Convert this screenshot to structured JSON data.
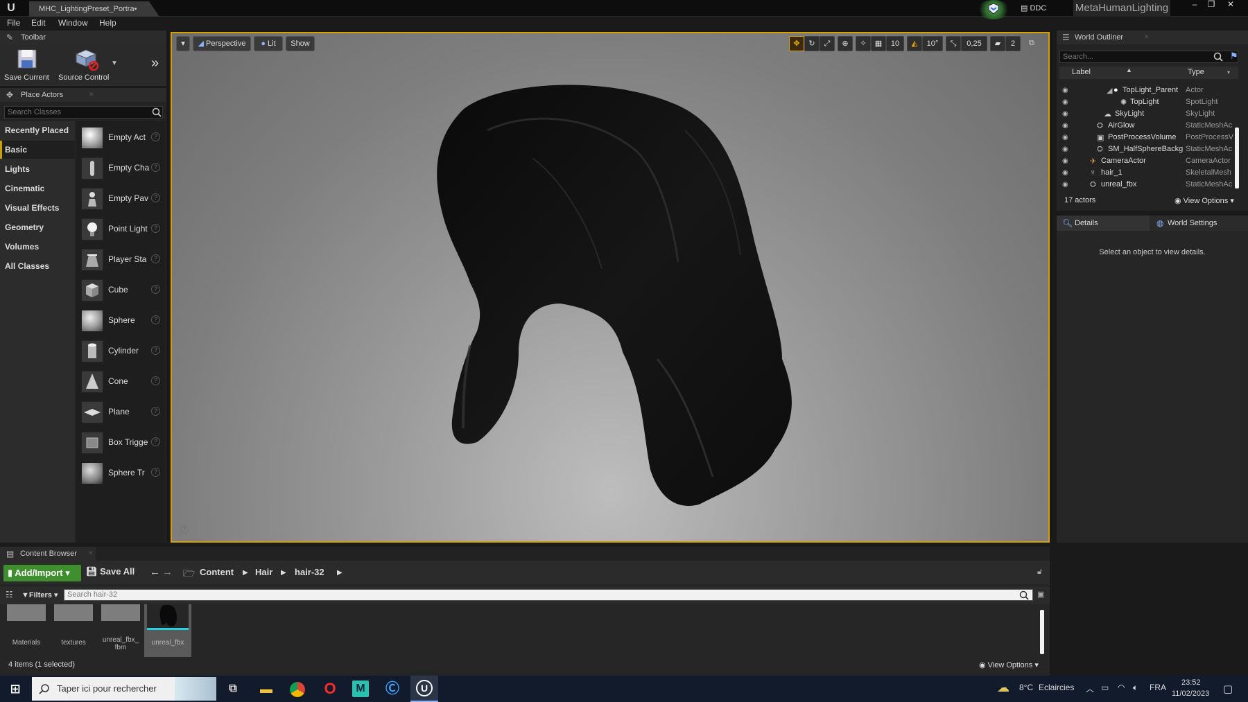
{
  "window": {
    "tab_title": "MHC_LightingPreset_Portra•",
    "ddc_label": "DDC",
    "project_name": "MetaHumanLighting"
  },
  "menu": {
    "items": [
      "File",
      "Edit",
      "Window",
      "Help"
    ]
  },
  "toolbar": {
    "title": "Toolbar",
    "save_label": "Save Current",
    "source_label": "Source Control"
  },
  "place_actors": {
    "title": "Place Actors",
    "search_placeholder": "Search Classes",
    "categories": [
      "Recently Placed",
      "Basic",
      "Lights",
      "Cinematic",
      "Visual Effects",
      "Geometry",
      "Volumes",
      "All Classes"
    ],
    "selected_category": "Basic",
    "items": [
      "Empty Act",
      "Empty Cha",
      "Empty Pav",
      "Point Light",
      "Player Sta",
      "Cube",
      "Sphere",
      "Cylinder",
      "Cone",
      "Plane",
      "Box Trigge",
      "Sphere Tr"
    ]
  },
  "viewport": {
    "perspective_label": "Perspective",
    "lit_label": "Lit",
    "show_label": "Show",
    "grid_snap": "10",
    "angle_snap": "10°",
    "scale_snap": "0,25",
    "camera_speed": "2"
  },
  "outliner": {
    "title": "World Outliner",
    "search_placeholder": "Search...",
    "col_label": "Label",
    "col_type": "Type",
    "rows": [
      {
        "label": "TopLight_Parent",
        "type": "Actor"
      },
      {
        "label": "TopLight",
        "type": "SpotLight"
      },
      {
        "label": "SkyLight",
        "type": "SkyLight"
      },
      {
        "label": "AirGlow",
        "type": "StaticMeshAc"
      },
      {
        "label": "PostProcessVolume",
        "type": "PostProcessV"
      },
      {
        "label": "SM_HalfSphereBackg",
        "type": "StaticMeshAc"
      },
      {
        "label": "CameraActor",
        "type": "CameraActor"
      },
      {
        "label": "hair_1",
        "type": "SkeletalMesh"
      },
      {
        "label": "unreal_fbx",
        "type": "StaticMeshAc"
      }
    ],
    "actor_count": "17 actors",
    "view_options": "View Options"
  },
  "details": {
    "tab_details": "Details",
    "tab_world_settings": "World Settings",
    "empty_message": "Select an object to view details."
  },
  "content_browser": {
    "title": "Content Browser",
    "add_import": "Add/Import",
    "save_all": "Save All",
    "breadcrumb": [
      "Content",
      "Hair",
      "hair-32"
    ],
    "filters": "Filters",
    "search_placeholder": "Search hair-32",
    "assets": [
      "Materials",
      "textures",
      "unreal_fbx_ fbm",
      "unreal_fbx"
    ],
    "status": "4 items (1 selected)",
    "view_options": "View Options"
  },
  "taskbar": {
    "search_placeholder": "Taper ici pour rechercher",
    "temperature": "8°C",
    "weather": "Eclaircies",
    "language": "FRA",
    "time": "23:52",
    "date": "11/02/2023"
  },
  "colors": {
    "accent": "#d9a100",
    "add_import_green": "#3f8f2f",
    "selection_cyan": "#2ad0e0",
    "taskbar": "#121b2b"
  }
}
